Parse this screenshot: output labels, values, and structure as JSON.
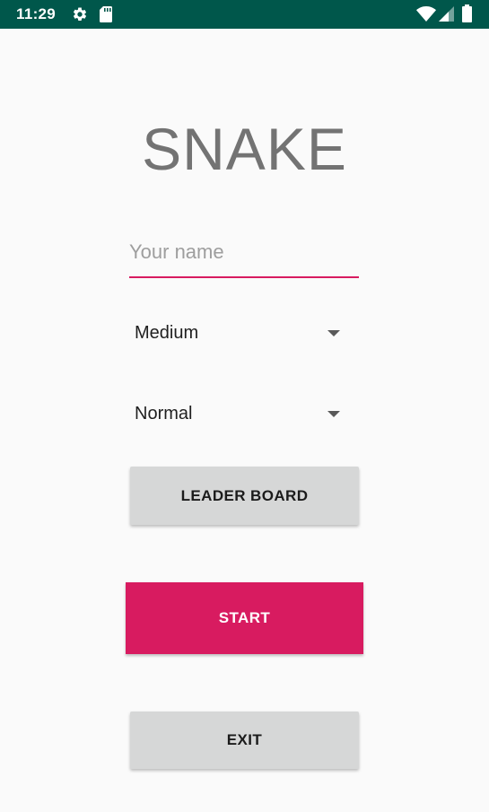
{
  "status_bar": {
    "time": "11:29",
    "background_color": "#00574b",
    "icons": [
      "gear-icon",
      "sd-card-icon",
      "wifi-icon",
      "cell-signal-icon",
      "battery-icon"
    ]
  },
  "app": {
    "title": "SNAKE",
    "accent_color": "#d81b60"
  },
  "name_input": {
    "placeholder": "Your name",
    "value": ""
  },
  "difficulty_spinner": {
    "selected": "Medium"
  },
  "mode_spinner": {
    "selected": "Normal"
  },
  "buttons": {
    "leader_board": "LEADER BOARD",
    "start": "START",
    "exit": "EXIT"
  }
}
